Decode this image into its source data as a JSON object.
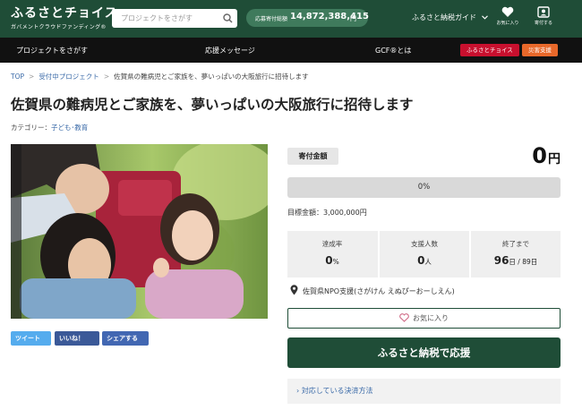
{
  "header": {
    "logo_main": "ふるさとチョイス",
    "logo_sub": "ガバメントクラウドファンディング®",
    "search_placeholder": "プロジェクトをさがす",
    "total_label": "応募寄付総額",
    "total_amount": "14,872,388,415",
    "total_unit": "円",
    "guide_label": "ふるさと納税ガイド",
    "favorites_label": "お気に入り",
    "donated_label": "寄付する"
  },
  "nav": {
    "find_projects": "プロジェクトをさがす",
    "messages": "応援メッセージ",
    "gcf_about": "GCF®とは",
    "furusato_choice": "ふるさとチョイス",
    "disaster_support": "災害支援",
    "colors": {
      "furusato": "#c8102e",
      "disaster": "#e8682a"
    }
  },
  "breadcrumb": [
    "TOP",
    "受付中プロジェクト",
    "佐賀県の難病児とご家族を、夢いっぱいの大阪旅行に招待します"
  ],
  "project": {
    "title": "佐賀県の難病児とご家族を、夢いっぱいの大阪旅行に招待します",
    "category_label": "カテゴリー：",
    "category_value": "子ども･教育"
  },
  "social": {
    "tweet": "ツイート",
    "like": "いいね！",
    "share": "シェアする"
  },
  "donation": {
    "label": "寄付金額",
    "amount": "0",
    "unit": "円",
    "progress_text": "0%",
    "progress_fraction": 0,
    "goal": "目標金額：3,000,000円"
  },
  "stats": {
    "rate_label": "達成率",
    "rate_value": "0",
    "rate_unit": "%",
    "supporters_label": "支援人数",
    "supporters_value": "0",
    "supporters_unit": "人",
    "remaining_label": "終了まで",
    "remaining_value": "96",
    "remaining_unit": "日 / 89日"
  },
  "organization": "佐賀県NPO支援(さがけん えぬぴーおーしえん)",
  "actions": {
    "favorite": "お気に入り",
    "support": "ふるさと納税で応援",
    "payment": "対応している決済方法"
  },
  "icons": [
    "search-icon",
    "chevron-down-icon",
    "heart-icon",
    "gift-icon",
    "map-pin-icon",
    "chevron-right-icon"
  ]
}
